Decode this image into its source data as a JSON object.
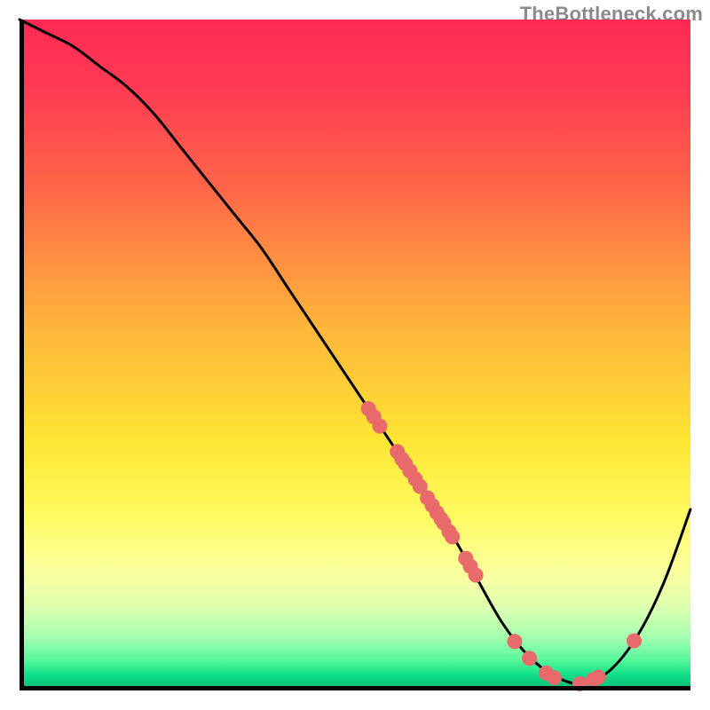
{
  "watermark": "TheBottleneck.com",
  "chart_data": {
    "type": "line",
    "title": "",
    "xlabel": "",
    "ylabel": "",
    "xlim": [
      0,
      100
    ],
    "ylim": [
      0,
      100
    ],
    "grid": false,
    "legend": false,
    "series": [
      {
        "name": "bottleneck-curve",
        "x": [
          0,
          4,
          8,
          12,
          16,
          20,
          24,
          28,
          32,
          36,
          40,
          44,
          48,
          52,
          56,
          60,
          64,
          68,
          72,
          76,
          80,
          84,
          88,
          92,
          96,
          100
        ],
        "y": [
          100,
          98,
          96,
          93,
          90,
          86,
          81,
          76,
          71,
          66,
          60,
          54,
          48,
          42,
          36,
          30,
          24,
          17,
          10,
          5,
          2,
          1,
          3,
          8,
          16,
          27
        ]
      }
    ],
    "markers": [
      {
        "x": 52,
        "y": 42
      },
      {
        "x": 52.8,
        "y": 40.8
      },
      {
        "x": 53.7,
        "y": 39.4
      },
      {
        "x": 56.3,
        "y": 35.6
      },
      {
        "x": 57.0,
        "y": 34.5
      },
      {
        "x": 57.5,
        "y": 33.8
      },
      {
        "x": 58.2,
        "y": 32.7
      },
      {
        "x": 59.0,
        "y": 31.5
      },
      {
        "x": 59.7,
        "y": 30.4
      },
      {
        "x": 60.8,
        "y": 28.7
      },
      {
        "x": 61.5,
        "y": 27.6
      },
      {
        "x": 62.2,
        "y": 26.5
      },
      {
        "x": 62.8,
        "y": 25.6
      },
      {
        "x": 63.2,
        "y": 25.0
      },
      {
        "x": 64.0,
        "y": 23.7
      },
      {
        "x": 64.5,
        "y": 22.9
      },
      {
        "x": 66.5,
        "y": 19.7
      },
      {
        "x": 67.2,
        "y": 18.5
      },
      {
        "x": 68.0,
        "y": 17.2
      },
      {
        "x": 73.8,
        "y": 7.3
      },
      {
        "x": 76.0,
        "y": 4.8
      },
      {
        "x": 78.5,
        "y": 2.6
      },
      {
        "x": 79.7,
        "y": 1.9
      },
      {
        "x": 83.5,
        "y": 1.0
      },
      {
        "x": 85.5,
        "y": 1.6
      },
      {
        "x": 86.3,
        "y": 2.0
      },
      {
        "x": 91.6,
        "y": 7.4
      }
    ],
    "colors": {
      "curve": "#000000",
      "markers": "#e86a6a",
      "gradient_top": "#ff2a55",
      "gradient_bottom": "#03b873"
    }
  }
}
